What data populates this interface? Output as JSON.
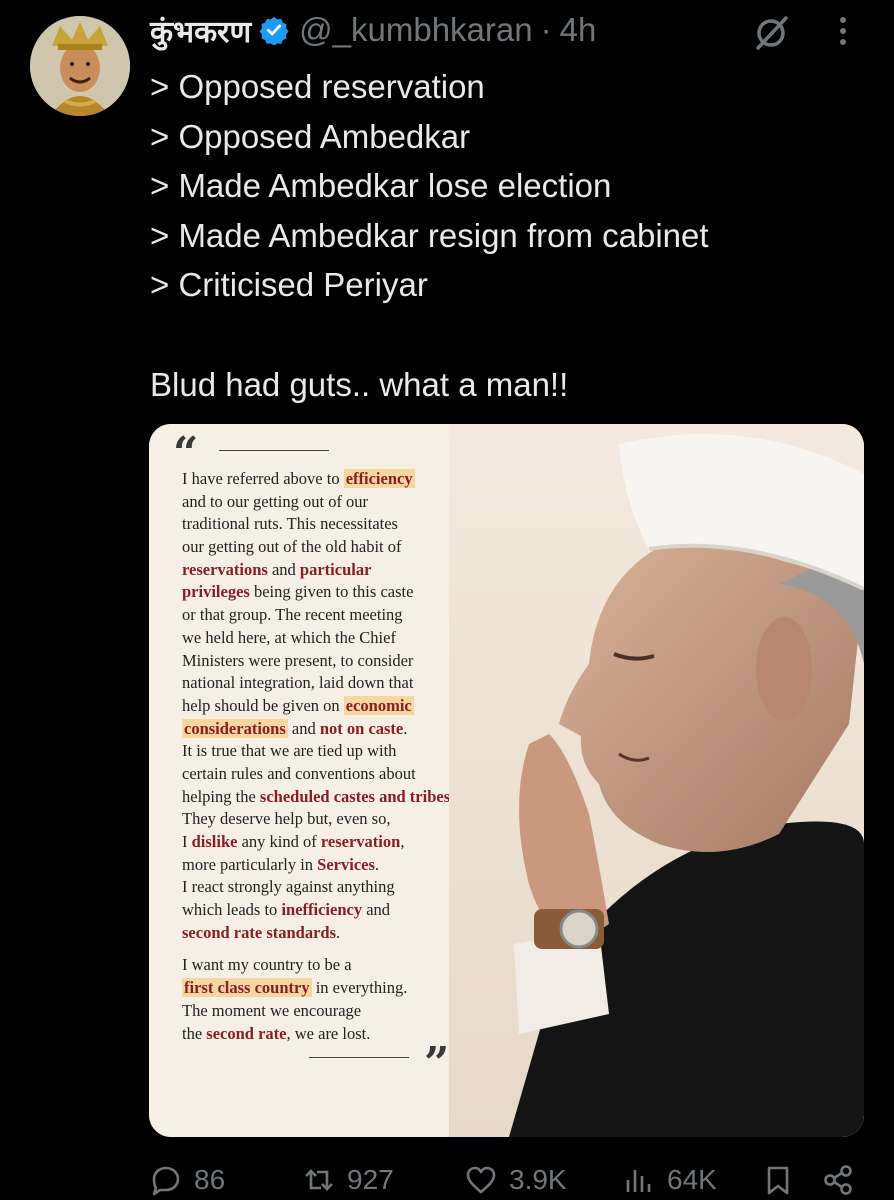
{
  "user": {
    "display_name": "कुंभकरण",
    "handle": "@_kumbhkaran",
    "separator": "·",
    "time": "4h",
    "verified": true
  },
  "tweet": {
    "lines": [
      "> Opposed reservation",
      "> Opposed Ambedkar",
      "> Made Ambedkar lose election",
      "> Made Ambedkar resign from cabinet",
      "> Criticised Periyar"
    ],
    "closing": "Blud had guts.. what a man!!"
  },
  "media": {
    "quote_open": "“",
    "quote_close": "”"
  },
  "actions": {
    "replies": "86",
    "reposts": "927",
    "likes": "3.9K",
    "views": "64K"
  },
  "colors": {
    "background": "#000000",
    "text": "#e7e9ea",
    "muted": "#71767b",
    "verified": "#1d9bf0",
    "highlight_text": "#8b1d24",
    "highlight_bg": "#f7d7a0"
  }
}
